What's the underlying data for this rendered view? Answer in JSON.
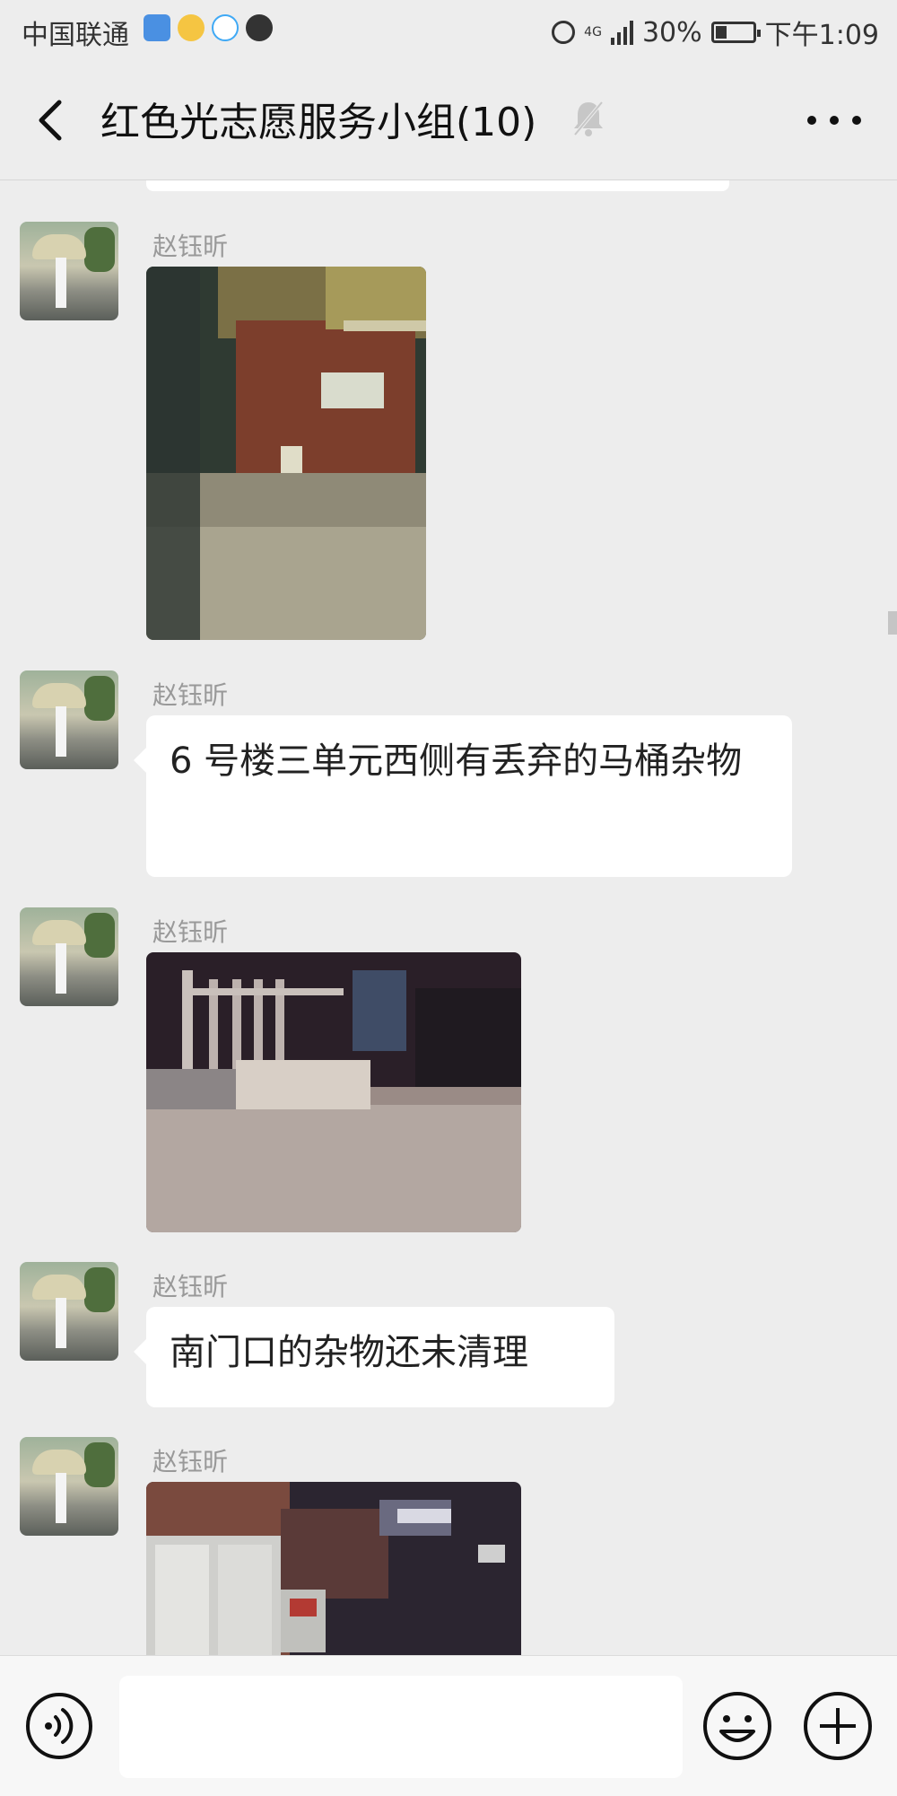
{
  "status_bar": {
    "carrier": "中国联通",
    "network": "4G",
    "battery": "30%",
    "battery_level": 0.3,
    "time": "下午1:09",
    "app_icons": [
      "shield-icon",
      "mail-icon",
      "qq-icon",
      "tiktok-icon"
    ]
  },
  "header": {
    "title": "红色光志愿服务小组(10)",
    "muted": true
  },
  "messages": [
    {
      "type": "image",
      "sender": "赵钰昕"
    },
    {
      "type": "text",
      "sender": "赵钰昕",
      "text": "6 号楼三单元西侧有丢弃的马桶杂物"
    },
    {
      "type": "image",
      "sender": "赵钰昕"
    },
    {
      "type": "text",
      "sender": "赵钰昕",
      "text": "南门口的杂物还未清理"
    },
    {
      "type": "image",
      "sender": "赵钰昕"
    }
  ],
  "input_bar": {
    "text_value": "",
    "icons": [
      "voice-icon",
      "emoji-icon",
      "plus-icon"
    ]
  },
  "colors": {
    "background": "#ededed",
    "bubble": "#ffffff",
    "sender_name": "#999999",
    "text": "#222222"
  }
}
